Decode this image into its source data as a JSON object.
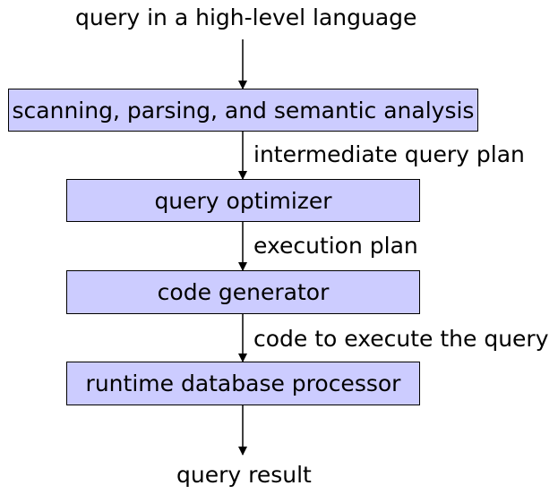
{
  "input_label": "query in a high-level language",
  "output_label": "query result",
  "stages": [
    {
      "label": "scanning, parsing, and semantic analysis"
    },
    {
      "label": "query optimizer"
    },
    {
      "label": "code generator"
    },
    {
      "label": "runtime database processor"
    }
  ],
  "edges": [
    {
      "label": "intermediate query plan"
    },
    {
      "label": "execution plan"
    },
    {
      "label": "code to execute the query"
    }
  ],
  "colors": {
    "box_fill": "#ccccff",
    "stroke": "#000000"
  }
}
